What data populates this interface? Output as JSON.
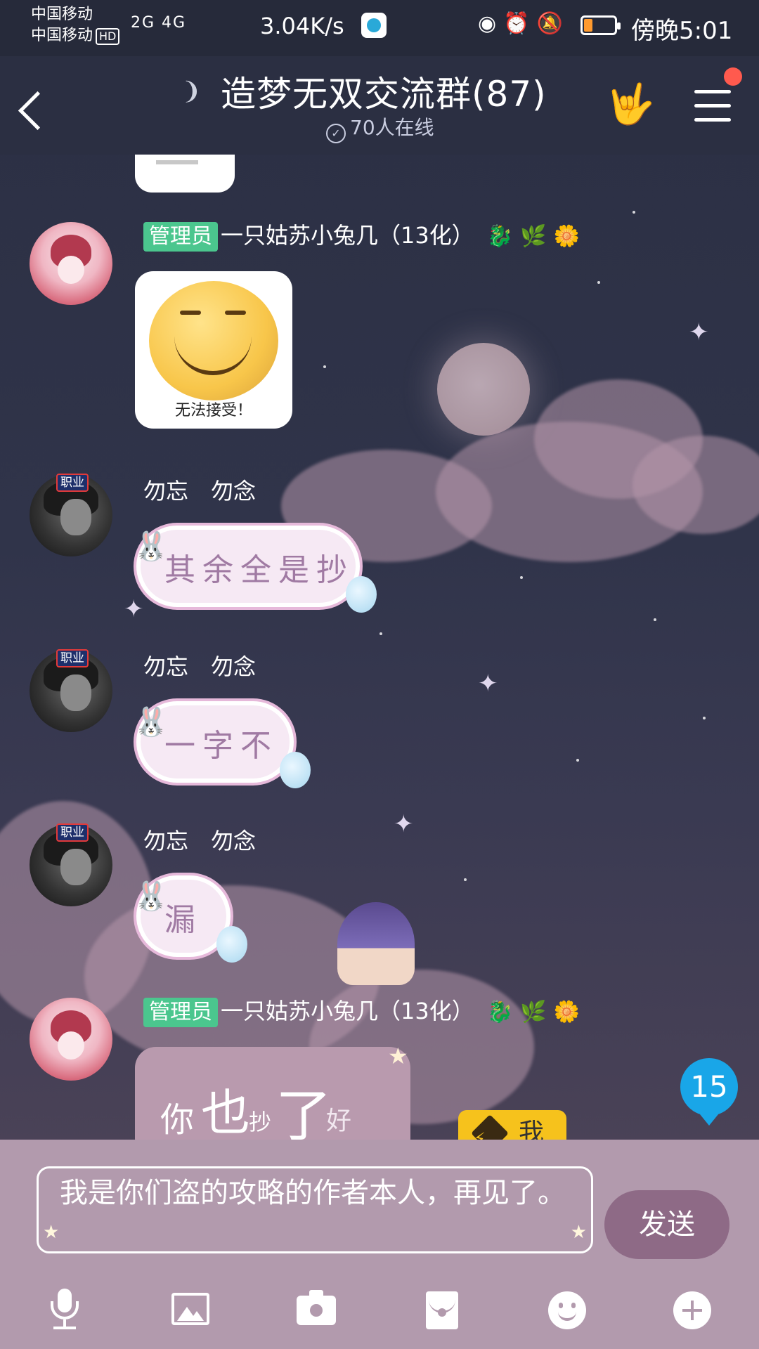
{
  "status_bar": {
    "carrier_1": "中国移动",
    "carrier_2": "中国移动",
    "hd_label": "HD",
    "signal_labels": "2G 4G",
    "net_speed": "3.04K/s",
    "time": "傍晚5:01",
    "icons": [
      "eye-icon",
      "alarm-icon",
      "mute-bell-icon",
      "battery-icon"
    ]
  },
  "header": {
    "title": "造梦无双交流群(87)",
    "online": "70人在线",
    "icons": [
      "back-icon",
      "ear-icon",
      "hand-icon",
      "menu-icon"
    ]
  },
  "messages": [
    {
      "sender": "一只姑苏小兔几（13化）",
      "role_tag": "管理员",
      "type": "sticker",
      "sticker_caption": "无法接受！"
    },
    {
      "sender": "勿忘　勿念",
      "badge": "职业",
      "type": "text",
      "text": "其余全是抄"
    },
    {
      "sender": "勿忘　勿念",
      "badge": "职业",
      "type": "text",
      "text": "一字不"
    },
    {
      "sender": "勿忘　勿念",
      "badge": "职业",
      "type": "text",
      "text": "漏"
    },
    {
      "sender": "一只姑苏小兔几（13化）",
      "role_tag": "管理员",
      "type": "text",
      "text_parts": [
        "你",
        "也",
        "抄",
        "了",
        "好"
      ]
    }
  ],
  "unread_count": "15",
  "me_chip": "我",
  "composer": {
    "value": "我是你们盗的攻略的作者本人，再见了。",
    "send_label": "发送"
  },
  "toolbar": [
    "mic-icon",
    "image-icon",
    "camera-icon",
    "red-packet-icon",
    "emoji-icon",
    "plus-icon"
  ],
  "colors": {
    "admin_tag": "#4bc68e",
    "unread_badge": "#19a6e8",
    "send_button": "#8e6a86",
    "input_bar": "#b29aad",
    "me_chip": "#f6c21c"
  }
}
